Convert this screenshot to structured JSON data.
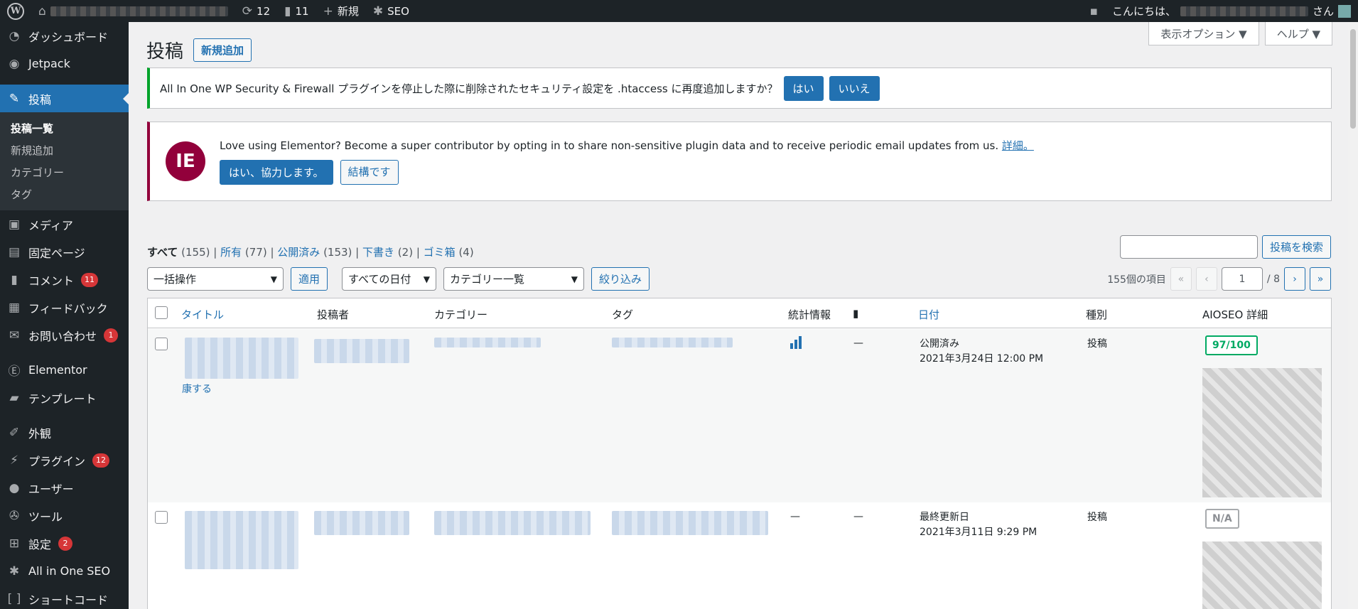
{
  "adminbar": {
    "updates_count": "12",
    "comments_count": "11",
    "new_label": "新規",
    "seo_label": "SEO",
    "greeting": "こんにちは、",
    "greeting_suffix": "さん"
  },
  "sidebar": {
    "items": [
      {
        "label": "ダッシュボード",
        "icon": "dashboard-icon"
      },
      {
        "label": "Jetpack",
        "icon": "jetpack-icon"
      },
      {
        "label": "投稿",
        "icon": "pin-icon"
      },
      {
        "label": "メディア",
        "icon": "media-icon"
      },
      {
        "label": "固定ページ",
        "icon": "page-icon"
      },
      {
        "label": "コメント",
        "icon": "comment-icon",
        "badge": "11"
      },
      {
        "label": "フィードバック",
        "icon": "feedback-icon"
      },
      {
        "label": "お問い合わせ",
        "icon": "mail-icon",
        "badge": "1"
      },
      {
        "label": "Elementor",
        "icon": "elementor-icon"
      },
      {
        "label": "テンプレート",
        "icon": "folder-icon"
      },
      {
        "label": "外観",
        "icon": "brush-icon"
      },
      {
        "label": "プラグイン",
        "icon": "plugin-icon",
        "badge": "12"
      },
      {
        "label": "ユーザー",
        "icon": "user-icon"
      },
      {
        "label": "ツール",
        "icon": "wrench-icon"
      },
      {
        "label": "設定",
        "icon": "settings-icon",
        "badge": "2"
      },
      {
        "label": "All in One SEO",
        "icon": "seo-icon"
      },
      {
        "label": "ショートコード",
        "icon": "shortcode-icon"
      }
    ],
    "submenu": [
      "投稿一覧",
      "新規追加",
      "カテゴリー",
      "タグ"
    ]
  },
  "screen_options": {
    "display": "表示オプション ▼",
    "help": "ヘルプ ▼"
  },
  "page": {
    "title": "投稿",
    "add_new": "新規追加"
  },
  "notice_security": {
    "text": "All In One WP Security & Firewall プラグインを停止した際に削除されたセキュリティ設定を .htaccess に再度追加しますか？",
    "yes": "はい",
    "no": "いいえ"
  },
  "notice_elementor": {
    "text": "Love using Elementor? Become a super contributor by opting in to share non-sensitive plugin data and to receive periodic email updates from us.",
    "link": "詳細。",
    "accept": "はい、協力します。",
    "decline": "結構です"
  },
  "filters": {
    "all": "すべて",
    "all_count": "(155)",
    "mine": "所有",
    "mine_count": "(77)",
    "published": "公開済み",
    "published_count": "(153)",
    "draft": "下書き",
    "draft_count": "(2)",
    "trash": "ゴミ箱",
    "trash_count": "(4)"
  },
  "search": {
    "button": "投稿を検索"
  },
  "tablenav": {
    "bulk": "一括操作",
    "apply": "適用",
    "dates": "すべての日付",
    "categories": "カテゴリー一覧",
    "filter": "絞り込み"
  },
  "pagination": {
    "items": "155個の項目",
    "first": "«",
    "prev": "‹",
    "current": "1",
    "total": "/ 8",
    "next": "›",
    "last": "»"
  },
  "table": {
    "columns": {
      "title": "タイトル",
      "author": "投稿者",
      "categories": "カテゴリー",
      "tags": "タグ",
      "stats": "統計情報",
      "date": "日付",
      "type": "種別",
      "aioseo": "AIOSEO 詳細"
    },
    "rows": [
      {
        "title_tail": "康する",
        "comments": "—",
        "status": "公開済み",
        "date": "2021年3月24日 12:00 PM",
        "type": "投稿",
        "score": "97/100"
      },
      {
        "stats": "—",
        "comments": "—",
        "status": "最終更新日",
        "date": "2021年3月11日 9:29 PM",
        "type": "投稿",
        "score": "N/A"
      }
    ]
  }
}
